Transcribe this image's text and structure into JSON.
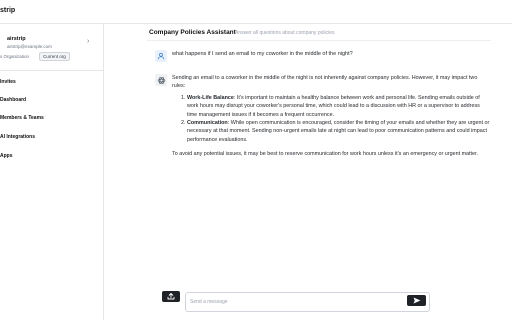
{
  "app": {
    "brand": "strip"
  },
  "account": {
    "name": "airstrip",
    "email": "airstrip@example.com",
    "org": "s Organization",
    "badge": "Current org"
  },
  "sidebar": {
    "items": [
      {
        "label": "Invites"
      },
      {
        "label": "Dashboard"
      },
      {
        "label": "Members & Teams"
      },
      {
        "label": "AI Integrations"
      },
      {
        "label": "Apps"
      }
    ]
  },
  "chat": {
    "title": "Company Policies Assistant",
    "subtitle": "Answer all questions about company policies",
    "user_message": "what happens if I send an email to my coworker in the middle of the night?",
    "answer": {
      "intro": "Sending an email to a coworker in the middle of the night is not inherently against company policies. However, it may impact two rules:",
      "points": [
        {
          "term": "Work-Life Balance",
          "text": ": It's important to maintain a healthy balance between work and personal life. Sending emails outside of work hours may disrupt your coworker's personal time, which could lead to a discussion with HR or a supervisor to address time management issues if it becomes a frequent occurrence."
        },
        {
          "term": "Communication",
          "text": ": While open communication is encouraged, consider the timing of your emails and whether they are urgent or necessary at that moment. Sending non-urgent emails late at night can lead to poor communication patterns and could impact performance evaluations."
        }
      ],
      "conclusion": "To avoid any potential issues, it may be best to reserve communication for work hours unless it's an emergency or urgent matter."
    }
  },
  "composer": {
    "placeholder": "Send a message",
    "value": ""
  },
  "icons": {
    "upload": "upload-icon",
    "send": "send-icon",
    "user_avatar": "user-icon",
    "assistant_avatar": "openai-icon",
    "chevron": "chevron-icon"
  },
  "colors": {
    "accent_dark": "#1f2328",
    "user_avatar_bg": "#e8f1fb",
    "user_avatar_fg": "#3b82c4",
    "muted_text": "#6b7280"
  }
}
